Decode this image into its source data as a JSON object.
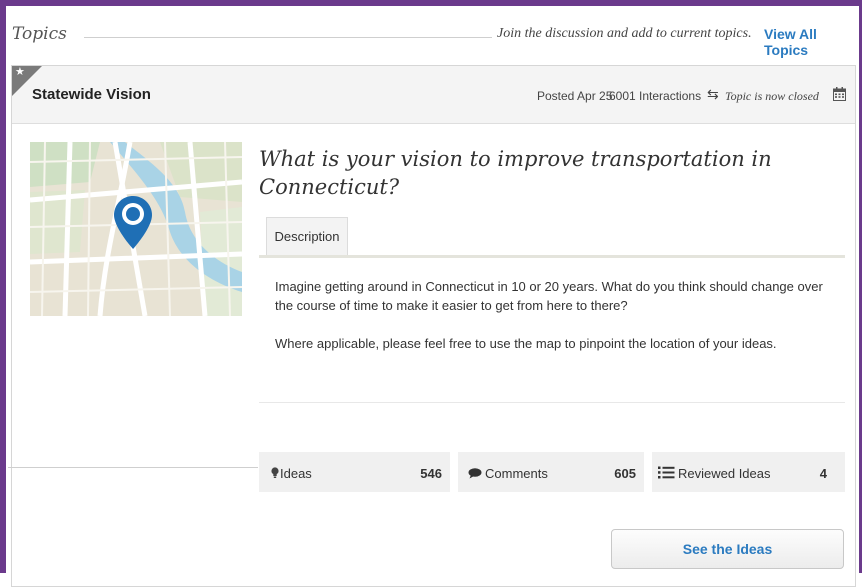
{
  "header": {
    "title": "Topics",
    "join_text": "Join the discussion and add to current topics.",
    "view_all_label": "View All Topics"
  },
  "topic": {
    "name": "Statewide Vision",
    "posted": "Posted Apr 25",
    "interactions": "6001 Interactions",
    "status": "Topic is now closed",
    "question": "What is your vision to improve transportation in Connecticut?",
    "tab_label": "Description",
    "description": [
      "Imagine getting around in Connecticut in 10 or 20 years. What do you think should change over the course of time to make it easier to get from here to there?",
      "Where applicable, please feel free to use the map to pinpoint the location of your ideas."
    ]
  },
  "stats": {
    "ideas_label": "Ideas",
    "ideas_count": "546",
    "comments_label": "Comments",
    "comments_count": "605",
    "reviewed_label": "Reviewed Ideas",
    "reviewed_count": "4"
  },
  "actions": {
    "see_ideas_label": "See the Ideas"
  },
  "icons": {
    "corner": "star-icon",
    "interactions": "swap-arrows-icon",
    "closed": "calendar-icon",
    "ideas": "lightbulb-icon",
    "comments": "speech-bubble-icon",
    "reviewed": "list-icon",
    "map_marker": "map-pin-icon"
  },
  "colors": {
    "accent": "#2b7bc0",
    "frame": "#6b3a8c",
    "marker": "#1f6fb5"
  }
}
